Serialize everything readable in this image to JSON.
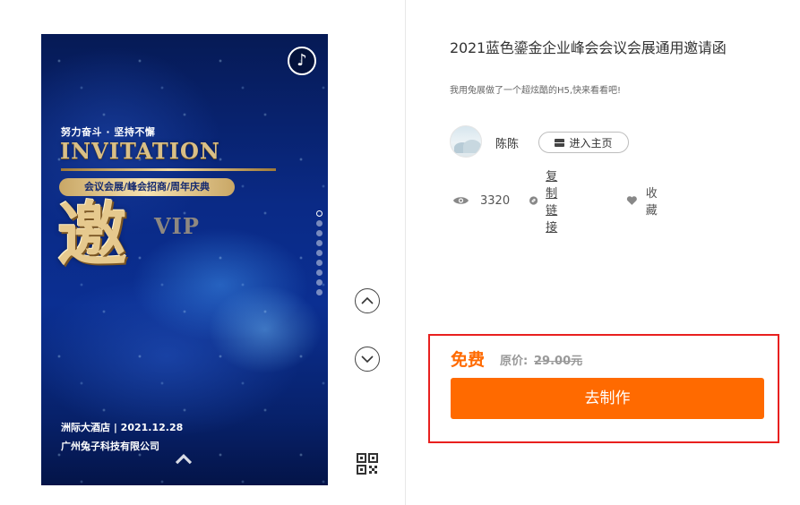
{
  "preview": {
    "slogan": "努力奋斗 · 坚持不懈",
    "invite_title": "INVITATION",
    "pill_text": "会议会展/峰会招商/周年庆典",
    "big_char": "邀",
    "vip": "VIP",
    "venue_line": "洲际大酒店 | 2021.12.28",
    "company_line": "广州兔子科技有限公司",
    "music_icon": "♪",
    "page_dots": {
      "count": 9,
      "active_index": 0
    }
  },
  "controls": {
    "prev_icon": "chevron-up-icon",
    "next_icon": "chevron-down-icon",
    "qr_icon": "qr-code-icon"
  },
  "info": {
    "title": "2021蓝色鎏金企业峰会会议会展通用邀请函",
    "description": "我用兔展做了一个超炫酷的H5,快来看看吧!",
    "author": "陈陈",
    "home_button": "进入主页",
    "views": "3320",
    "copy_link": "复制链接",
    "favorite": "收藏"
  },
  "purchase": {
    "free_label": "免费",
    "original_label": "原价:",
    "original_price": "29.00元",
    "make_button": "去制作"
  },
  "colors": {
    "accent": "#ff6a00",
    "highlight_border": "#e8201f",
    "gold": "#d9bf86",
    "preview_bg": "#0a2a86"
  }
}
